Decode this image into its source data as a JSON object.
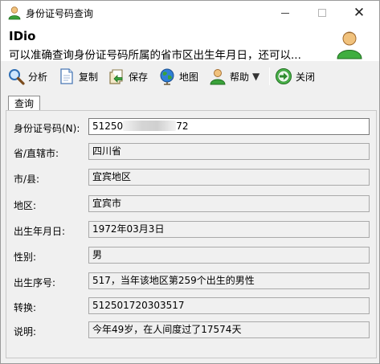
{
  "window": {
    "title": "身份证号码查询"
  },
  "banner": {
    "title": "IDio",
    "description": "可以准确查询身份证号码所属的省市区出生年月日，还可以..."
  },
  "toolbar": {
    "items": [
      {
        "label": "分析",
        "icon": "magnifier-icon"
      },
      {
        "label": "复制",
        "icon": "document-icon"
      },
      {
        "label": "保存",
        "icon": "save-arrow-icon"
      },
      {
        "label": "地图",
        "icon": "globe-icon"
      },
      {
        "label": "帮助",
        "icon": "user-help-icon"
      },
      {
        "label": "关闭",
        "icon": "exit-arrow-icon"
      }
    ]
  },
  "tab": {
    "label": "查询"
  },
  "form": {
    "id_number": {
      "label": "身份证号码(N):",
      "value_start": "51250",
      "value_end": "72"
    },
    "province": {
      "label": "省/直辖市:",
      "value": "四川省"
    },
    "city": {
      "label": "市/县:",
      "value": "宜宾地区"
    },
    "district": {
      "label": "地区:",
      "value": "宜宾市"
    },
    "birthdate": {
      "label": "出生年月日:",
      "value": "1972年03月3日"
    },
    "gender": {
      "label": "性别:",
      "value": "男"
    },
    "sequence": {
      "label": "出生序号:",
      "value": "517，当年该地区第259个出生的男性"
    },
    "convert": {
      "label": "转换:",
      "value": "512501720303517"
    },
    "note": {
      "label": "说明:",
      "value": "今年49岁，在人间度过了17574天"
    }
  },
  "colors": {
    "accent_green": "#3aa23a",
    "window_bg": "#f0f0f0",
    "field_border": "#a9a9a9"
  }
}
